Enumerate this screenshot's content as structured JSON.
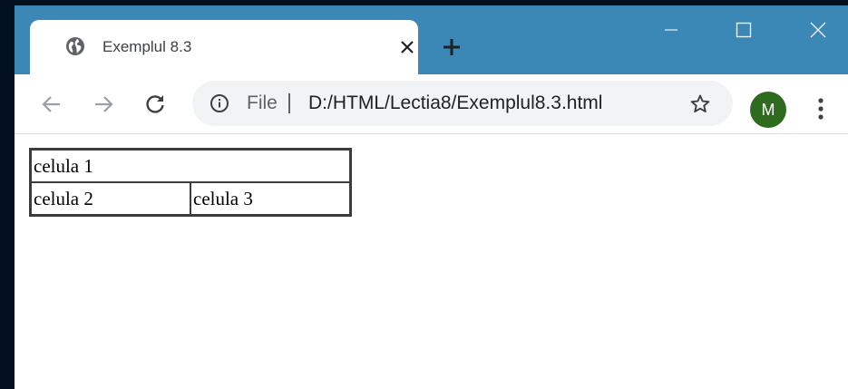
{
  "tab": {
    "title": "Exemplul 8.3"
  },
  "address_bar": {
    "scheme_label": "File",
    "url": "D:/HTML/Lectia8/Exemplul8.3.html"
  },
  "profile": {
    "initial": "M",
    "color": "#2e6b1e"
  },
  "titlebar_color": "#3b87b5",
  "icons": {
    "tab": "globe-icon",
    "tab_close": "close-icon",
    "new_tab": "plus-icon",
    "minimize": "minimize-icon",
    "maximize": "maximize-icon",
    "close": "close-icon",
    "back": "back-arrow-icon",
    "forward": "forward-arrow-icon",
    "reload": "reload-icon",
    "info": "info-icon",
    "bookmark": "star-icon",
    "menu": "kebab-menu-icon"
  },
  "table": {
    "rows": [
      [
        "celula 1"
      ],
      [
        "celula 2",
        "celula 3"
      ]
    ]
  }
}
